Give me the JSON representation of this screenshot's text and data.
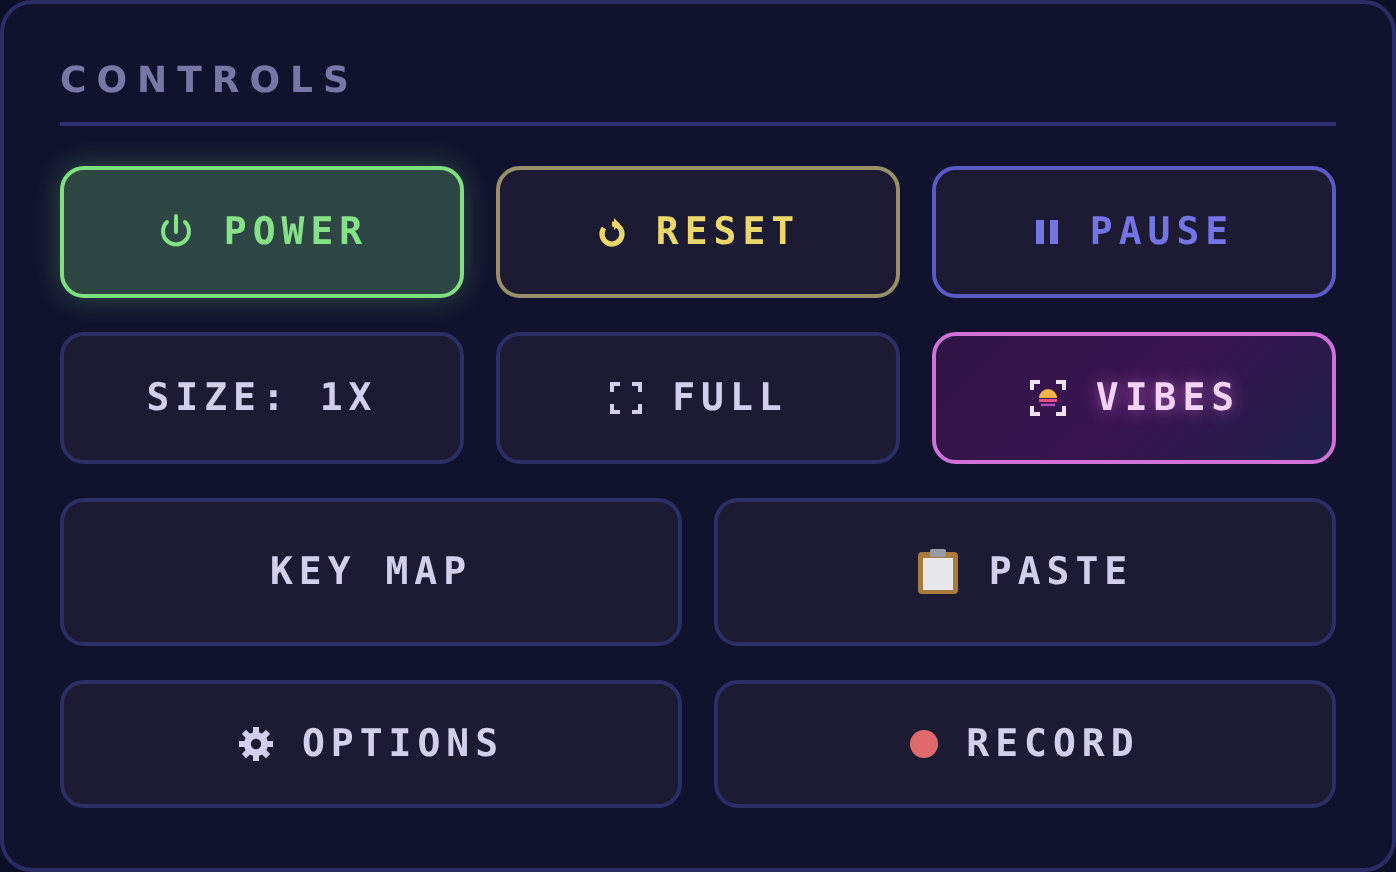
{
  "panel": {
    "title": "CONTROLS"
  },
  "rows": [
    [
      {
        "label": "POWER",
        "kind": "active"
      },
      {
        "label": "RESET",
        "kind": "warning"
      },
      {
        "label": "PAUSE",
        "kind": "accent"
      }
    ],
    [
      {
        "label": "SIZE: 1X",
        "kind": "plain"
      },
      {
        "label": "FULL",
        "kind": "plain"
      },
      {
        "label": "VIBES",
        "kind": "glow"
      }
    ],
    [
      {
        "label": "KEY MAP",
        "kind": "plain"
      },
      {
        "label": "PASTE",
        "kind": "plain"
      }
    ],
    [
      {
        "label": "OPTIONS",
        "kind": "plain"
      },
      {
        "label": "RECORD",
        "kind": "plain"
      }
    ]
  ]
}
